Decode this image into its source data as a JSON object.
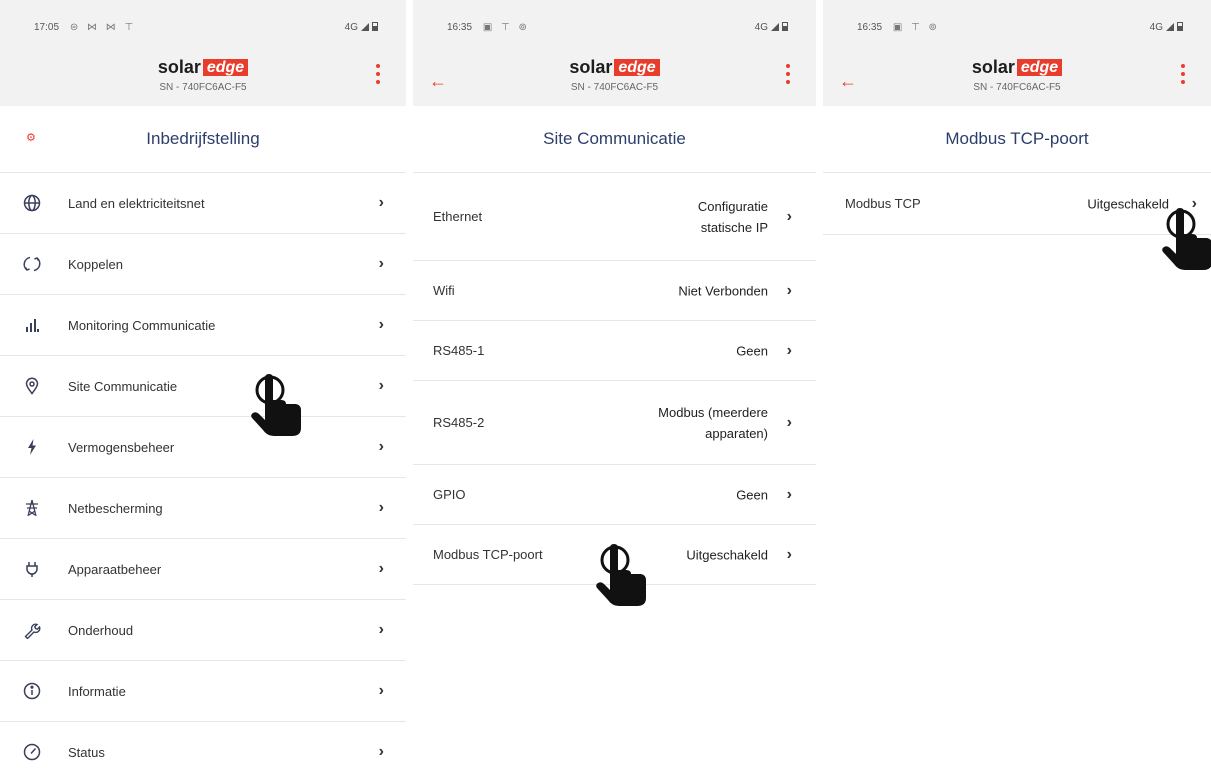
{
  "brand": {
    "solar": "solar",
    "edge": "edge",
    "serial": "SN - 740FC6AC-F5"
  },
  "screens": [
    {
      "status": {
        "time": "17:05",
        "icons": "⊜ ⋈ ⋈ ⊤",
        "network": "4G"
      },
      "title": "Inbedrijfstelling",
      "items": [
        {
          "label": "Land en elektriciteitsnet",
          "icon": "globe-icon"
        },
        {
          "label": "Koppelen",
          "icon": "pairing-icon"
        },
        {
          "label": "Monitoring Communicatie",
          "icon": "signal-bars-icon"
        },
        {
          "label": "Site Communicatie",
          "icon": "location-pin-icon"
        },
        {
          "label": "Vermogensbeheer",
          "icon": "lightning-icon"
        },
        {
          "label": "Netbescherming",
          "icon": "power-tower-icon"
        },
        {
          "label": "Apparaatbeheer",
          "icon": "plug-icon"
        },
        {
          "label": "Onderhoud",
          "icon": "wrench-icon"
        },
        {
          "label": "Informatie",
          "icon": "info-icon"
        },
        {
          "label": "Status",
          "icon": "gauge-icon"
        }
      ]
    },
    {
      "status": {
        "time": "16:35",
        "icons": "▣ ⊤ ⊚",
        "network": "4G"
      },
      "title": "Site Communicatie",
      "items": [
        {
          "label": "Ethernet",
          "value_1": "Configuratie",
          "value_2": "statische IP"
        },
        {
          "label": "Wifi",
          "value_1": "Niet Verbonden"
        },
        {
          "label": "RS485-1",
          "value_1": "Geen"
        },
        {
          "label": "RS485-2",
          "value_1": "Modbus (meerdere",
          "value_2": "apparaten)"
        },
        {
          "label": "GPIO",
          "value_1": "Geen"
        },
        {
          "label": "Modbus TCP-poort",
          "value_1": "Uitgeschakeld"
        }
      ]
    },
    {
      "status": {
        "time": "16:35",
        "icons": "▣ ⊤ ⊚",
        "network": "4G"
      },
      "title": "Modbus TCP-poort",
      "items": [
        {
          "label": "Modbus TCP",
          "value_1": "Uitgeschakeld"
        }
      ]
    }
  ],
  "colors": {
    "accent": "#e83d2c",
    "title": "#2c3e6b",
    "header_bg": "#f2f2f2"
  }
}
